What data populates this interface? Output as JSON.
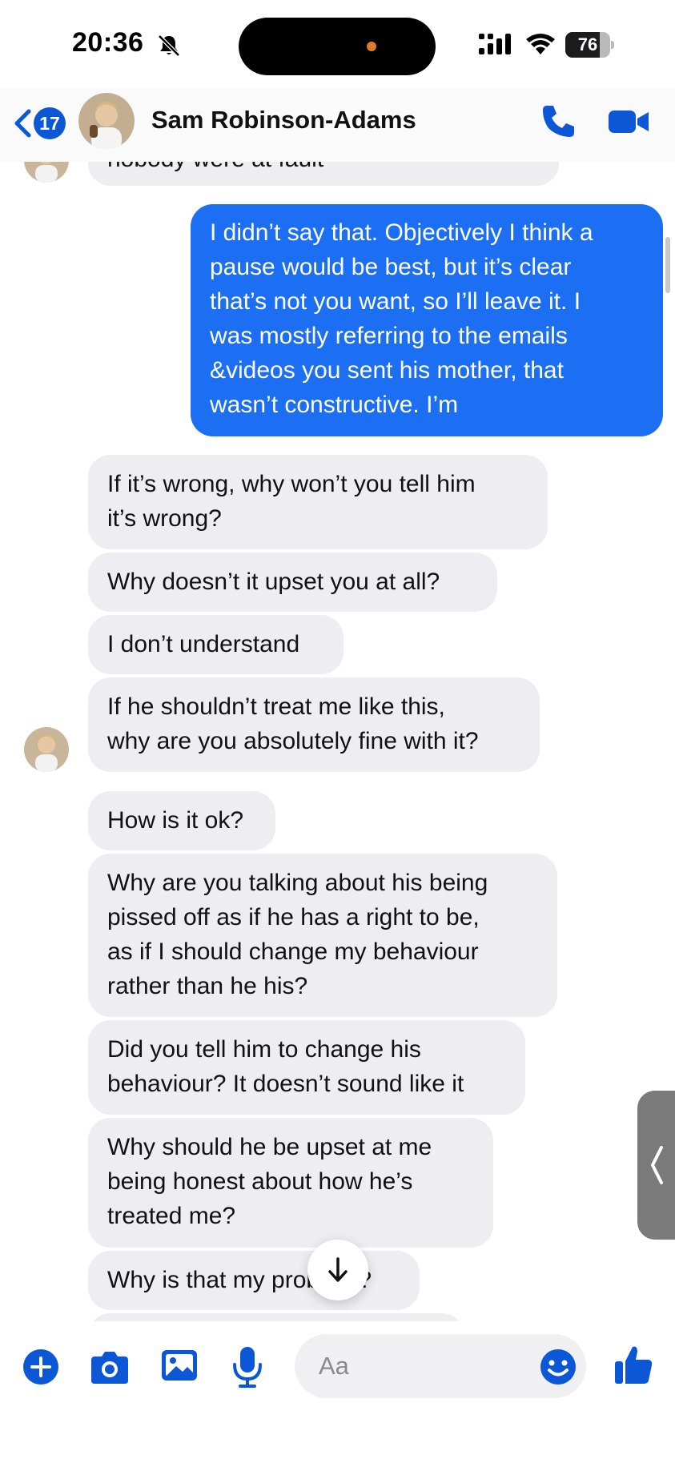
{
  "status_bar": {
    "time": "20:36",
    "battery": "76",
    "battery_level": 0.76,
    "icons": [
      "bell-slash-icon",
      "cellular-signal-icon",
      "wifi-icon",
      "battery-icon"
    ]
  },
  "header": {
    "back_badge_count": "17",
    "contact_name": "Sam Robinson-Adams",
    "icons": [
      "chevron-left-icon",
      "phone-icon",
      "video-camera-icon"
    ]
  },
  "messages": [
    {
      "direction": "in",
      "text": "nobody were at fault"
    },
    {
      "direction": "out",
      "lines": [
        "I didn’t say that. Objectively I think a",
        "pause would be best, but it’s clear",
        "that’s not you want, so I’ll leave it. I",
        "was mostly referring to the emails",
        "&videos you sent his mother, that",
        "wasn’t constructive. I’m"
      ]
    },
    {
      "direction": "in",
      "lines": [
        "If it’s wrong, why won’t you tell him",
        "it’s wrong?"
      ]
    },
    {
      "direction": "in",
      "lines": [
        "Why doesn’t it upset you at all?"
      ]
    },
    {
      "direction": "in",
      "lines": [
        "I don’t understand"
      ]
    },
    {
      "direction": "in",
      "lines": [
        "If he shouldn’t treat me like this,",
        "why are you absolutely fine with it?"
      ]
    },
    {
      "direction": "in",
      "lines": [
        "How is it ok?"
      ]
    },
    {
      "direction": "in",
      "lines": [
        "Why are you talking about his being",
        "pissed off as if he has a right to be,",
        "as if I should change my behaviour",
        "rather than he his?"
      ]
    },
    {
      "direction": "in",
      "lines": [
        "Did you tell him to change his",
        "behaviour? It doesn’t sound like it"
      ]
    },
    {
      "direction": "in",
      "lines": [
        "Why should he be upset at me",
        "being honest about how he’s",
        "treated me?"
      ]
    },
    {
      "direction": "in",
      "lines": [
        "Why is that my problem?"
      ]
    }
  ],
  "composer": {
    "placeholder": "Aa",
    "icons": [
      "plus-icon",
      "camera-icon",
      "photo-icon",
      "microphone-icon",
      "emoji-icon",
      "thumbs-up-icon"
    ]
  },
  "colors": {
    "accent": "#0b57d6",
    "outgoing_bubble": "#1c6ef2",
    "incoming_bubble": "#eeeef2"
  }
}
